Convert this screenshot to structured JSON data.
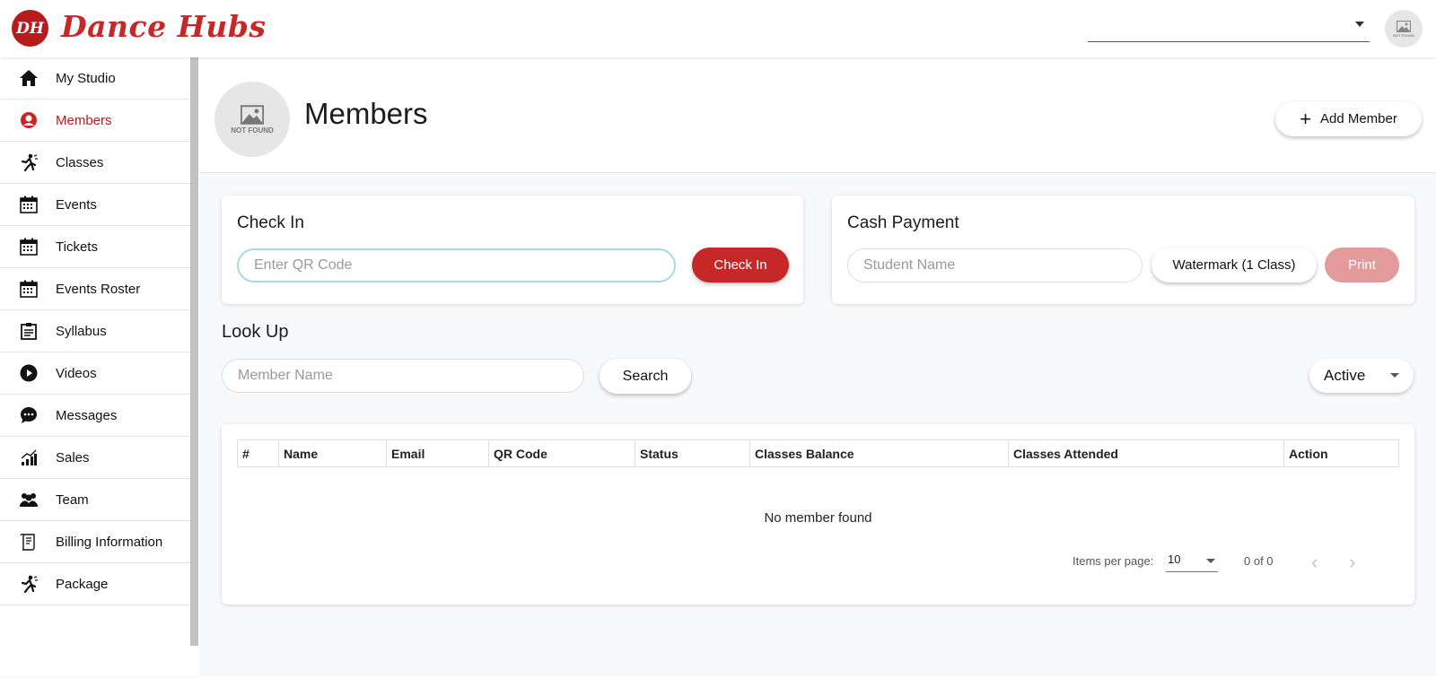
{
  "brand": {
    "logo_initials": "DH",
    "name": "Dance Hubs"
  },
  "header": {
    "studio_select_value": "",
    "avatar_text": "NOT FOUND"
  },
  "sidebar": {
    "items": [
      {
        "label": "My Studio",
        "icon": "home-icon"
      },
      {
        "label": "Members",
        "icon": "member-icon",
        "active": true
      },
      {
        "label": "Classes",
        "icon": "dancer-icon"
      },
      {
        "label": "Events",
        "icon": "calendar-icon"
      },
      {
        "label": "Tickets",
        "icon": "calendar-icon"
      },
      {
        "label": "Events Roster",
        "icon": "calendar-icon"
      },
      {
        "label": "Syllabus",
        "icon": "clipboard-icon"
      },
      {
        "label": "Videos",
        "icon": "play-icon"
      },
      {
        "label": "Messages",
        "icon": "chat-icon"
      },
      {
        "label": "Sales",
        "icon": "chart-icon"
      },
      {
        "label": "Team",
        "icon": "team-icon"
      },
      {
        "label": "Billing Information",
        "icon": "receipt-icon"
      },
      {
        "label": "Package",
        "icon": "dancer-icon"
      }
    ]
  },
  "page": {
    "title": "Members",
    "avatar_text": "NOT FOUND",
    "add_member_label": "Add Member"
  },
  "check_in": {
    "title": "Check In",
    "qr_placeholder": "Enter QR Code",
    "button_label": "Check In"
  },
  "cash_payment": {
    "title": "Cash Payment",
    "student_placeholder": "Student Name",
    "watermark_label": "Watermark (1 Class)",
    "print_label": "Print"
  },
  "lookup": {
    "title": "Look Up",
    "member_placeholder": "Member Name",
    "search_label": "Search",
    "status_value": "Active"
  },
  "table": {
    "columns": [
      "#",
      "Name",
      "Email",
      "QR Code",
      "Status",
      "Classes Balance",
      "Classes Attended",
      "Action"
    ],
    "empty_message": "No member found",
    "items_per_page_label": "Items per page:",
    "items_per_page_value": "10",
    "range_label": "0 of 0"
  },
  "colors": {
    "accent": "#c62828",
    "accent_disabled": "#e39a9a",
    "background": "#f8f9fa"
  }
}
